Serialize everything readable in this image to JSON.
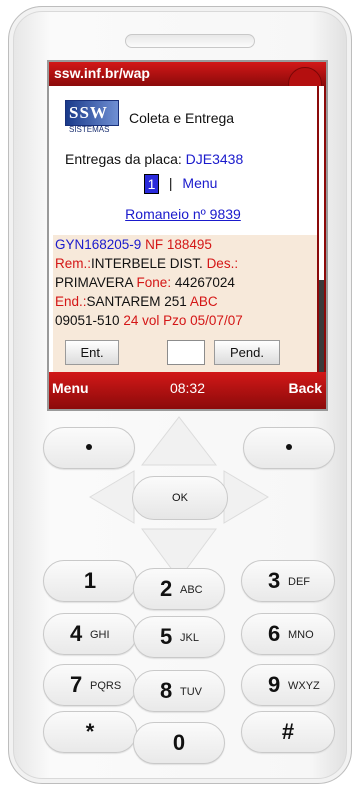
{
  "browser": {
    "title": "ssw.inf.br/wap"
  },
  "header": {
    "logo_text": "SSW",
    "logo_sub": "SISTEMAS",
    "service": "Coleta e Entrega"
  },
  "delivery": {
    "plate_label": "Entregas da placa:",
    "plate_value": "DJE3438",
    "page_number": "1",
    "separator": "|",
    "menu_link": "Menu",
    "romaneio": "Romaneio nº 9839"
  },
  "detail": {
    "code": "GYN168205-9",
    "nf_label": "NF",
    "nf_value": "188495",
    "rem_label": "Rem.:",
    "rem_value": "INTERBELE DIST.",
    "des_label": "Des.:",
    "des_value": "PRIMAVERA",
    "fone_label": "Fone:",
    "fone_value": "44267024",
    "end_label": "End.:",
    "end_value": "SANTAREM 251",
    "city": "ABC",
    "cep": "09051-510",
    "volumes": "24 vol",
    "pzo_label": "Pzo",
    "pzo_value": "05/07/07"
  },
  "actions": {
    "ent_label": "Ent.",
    "pend_label": "Pend.",
    "field_value": ""
  },
  "softkeys": {
    "left": "Menu",
    "time": "08:32",
    "right": "Back"
  },
  "keypad": {
    "ok": "OK",
    "keys": [
      {
        "n": "1",
        "s": ""
      },
      {
        "n": "2",
        "s": "ABC"
      },
      {
        "n": "3",
        "s": "DEF"
      },
      {
        "n": "4",
        "s": "GHI"
      },
      {
        "n": "5",
        "s": "JKL"
      },
      {
        "n": "6",
        "s": "MNO"
      },
      {
        "n": "7",
        "s": "PQRS"
      },
      {
        "n": "8",
        "s": "TUV"
      },
      {
        "n": "9",
        "s": "WXYZ"
      },
      {
        "n": "*",
        "s": ""
      },
      {
        "n": "0",
        "s": ""
      },
      {
        "n": "#",
        "s": ""
      }
    ]
  },
  "colors": {
    "accent": "#b40f0f",
    "link": "#1a1acc",
    "highlight": "#d41616",
    "panel": "#f7e9da"
  }
}
